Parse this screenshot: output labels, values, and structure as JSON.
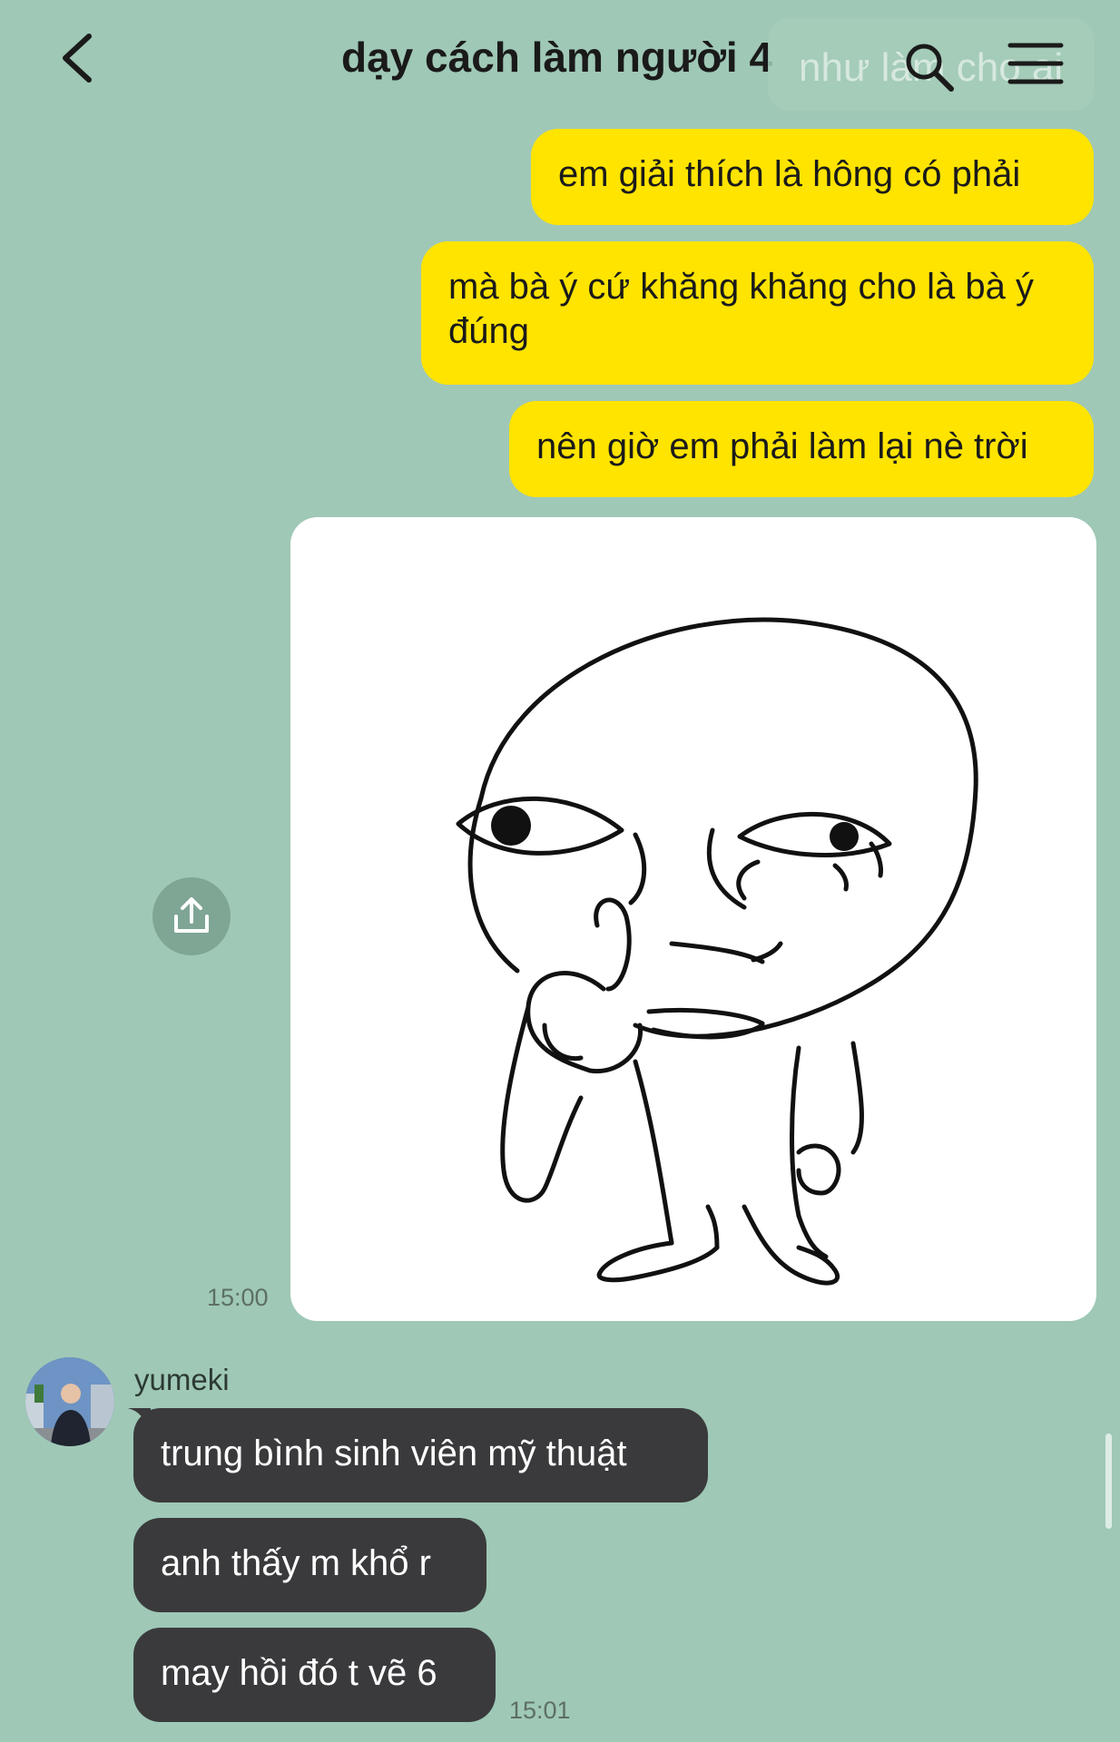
{
  "header": {
    "title": "dạy cách làm người 4",
    "search_ghost_text": "như làm cho ai",
    "back_icon": "chevron-left-icon",
    "search_icon": "search-icon",
    "menu_icon": "hamburger-menu-icon"
  },
  "messages": {
    "outgoing": [
      "em giải thích là hông có phải",
      "mà bà ý cứ khăng khăng cho là bà ý đúng",
      "nên giờ em phải làm lại nè trời"
    ],
    "sticker_time": "15:00",
    "sender_name": "yumeki",
    "incoming": [
      "trung bình sinh viên mỹ thuật",
      "anh thấy m khổ r",
      "may hồi đó t vẽ 6"
    ],
    "incoming_time": "15:01"
  },
  "colors": {
    "background": "#9fc8b6",
    "outgoing_bubble": "#ffe400",
    "incoming_bubble": "#3a3a3c"
  },
  "icons": {
    "share": "share-upload-icon"
  }
}
